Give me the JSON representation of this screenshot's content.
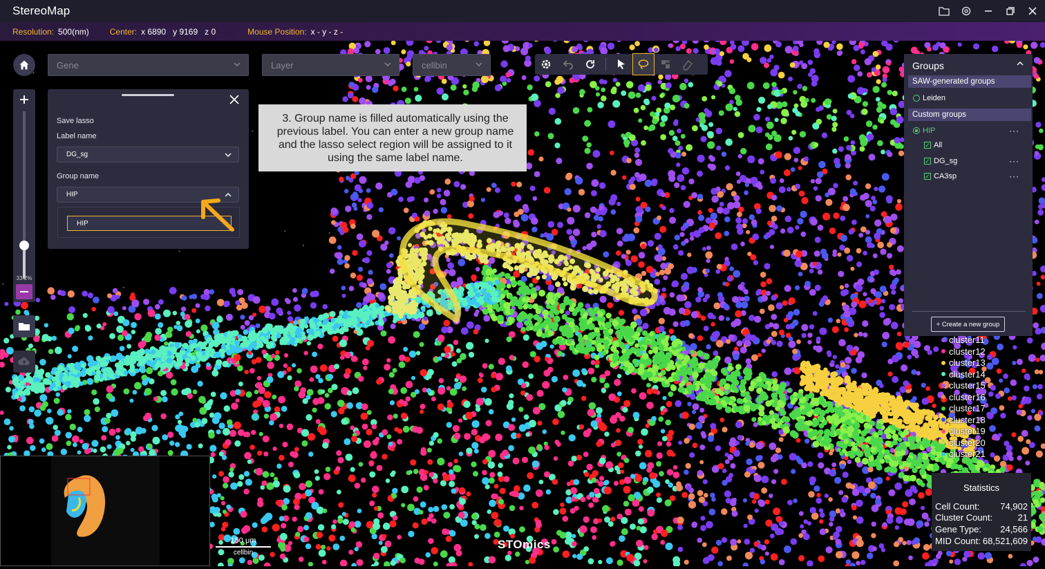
{
  "app": {
    "title": "StereoMap"
  },
  "infobar": {
    "resolution_key": "Resolution:",
    "resolution_val": "500(nm)",
    "center_key": "Center:",
    "center_x": "x 6890",
    "center_y": "y 9169",
    "center_z": "z 0",
    "mouse_key": "Mouse Position:",
    "mouse_val": "x -  y -  z -"
  },
  "dropdowns": {
    "gene": "Gene",
    "layer": "Layer",
    "cellbin": "cellbin"
  },
  "toolbar": {
    "icons": [
      "gear-icon",
      "undo-icon",
      "redo-icon",
      "pointer-icon",
      "lasso-icon",
      "brush-icon",
      "eraser-icon"
    ],
    "active": "lasso-icon"
  },
  "zoom": {
    "label": "33.2%",
    "level_fraction": 0.2
  },
  "lasso_panel": {
    "heading": "Save lasso",
    "label_name_label": "Label name",
    "label_name_value": "DG_sg",
    "group_name_label": "Group name",
    "group_name_value": "HIP",
    "group_input_value": "HIP"
  },
  "callout": {
    "text": "3. Group name is filled automatically using the previous label. You can enter a new group name and the lasso select region will be assigned to it using the same label name."
  },
  "groups": {
    "title": "Groups",
    "saw_section": "SAW-generated groups",
    "saw_items": [
      {
        "label": "Leiden",
        "selected": false
      }
    ],
    "custom_section": "Custom groups",
    "custom_group": {
      "label": "HIP",
      "selected": true
    },
    "labels": [
      {
        "label": "All",
        "checked": true
      },
      {
        "label": "DG_sg",
        "checked": true
      },
      {
        "label": "CA3sp",
        "checked": true
      }
    ],
    "more": "···",
    "create_button": "+  Create a new group"
  },
  "legend": {
    "items": [
      {
        "label": "cluster11",
        "color": "#a04ef0"
      },
      {
        "label": "cluster12",
        "color": "#ff2fa0"
      },
      {
        "label": "cluster13",
        "color": "#f7d040"
      },
      {
        "label": "cluster14",
        "color": "#5af0c0"
      },
      {
        "label": "cluster15",
        "color": "#9a5cf0"
      },
      {
        "label": "cluster16",
        "color": "#f08a5a"
      },
      {
        "label": "cluster17",
        "color": "#4ad84a"
      },
      {
        "label": "cluster18",
        "color": "#2a4af0"
      },
      {
        "label": "cluster19",
        "color": "#ff4a7a"
      },
      {
        "label": "cluster20",
        "color": "#b8e05a"
      },
      {
        "label": "cluster21",
        "color": "#3ac8f0"
      }
    ]
  },
  "stats": {
    "title": "Statistics",
    "rows": [
      {
        "key": "Cell Count:",
        "val": "74,902"
      },
      {
        "key": "Cluster Count:",
        "val": "21"
      },
      {
        "key": "Gene Type:",
        "val": "24,566"
      },
      {
        "key": "MID Count:",
        "val": "68,521,609"
      }
    ]
  },
  "scalebar": {
    "length": "150 μm",
    "layer": "cellbin"
  },
  "brand": "STOmics",
  "colors": {
    "accent": "#f2b632",
    "panel": "#2c2c3e",
    "section": "#4a4670",
    "check": "#5ad07a"
  }
}
